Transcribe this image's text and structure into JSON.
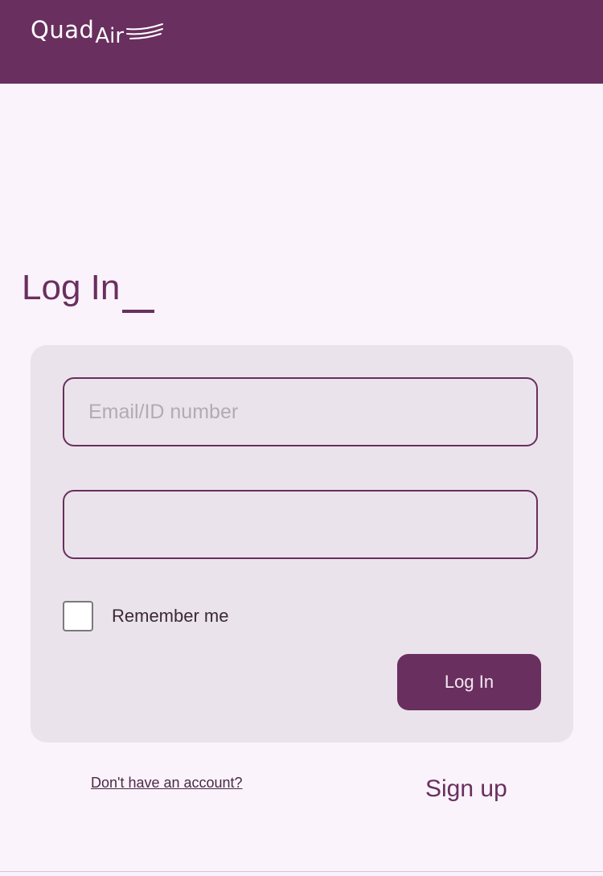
{
  "header": {
    "logo_primary": "Quad",
    "logo_secondary": "Air",
    "background_color": "#692f5f"
  },
  "login": {
    "title": "Log In",
    "email_field": {
      "placeholder": "Email/ID number",
      "value": ""
    },
    "password_field": {
      "placeholder": "",
      "value": ""
    },
    "remember_me": {
      "label": "Remember me",
      "checked": false
    },
    "submit_label": "Log In"
  },
  "footer": {
    "no_account_text": "Don't have an account?",
    "sign_up_label": "Sign up"
  },
  "colors": {
    "brand": "#692f5f",
    "page_background": "#faf3fb",
    "card_background": "#ebe3eb"
  }
}
